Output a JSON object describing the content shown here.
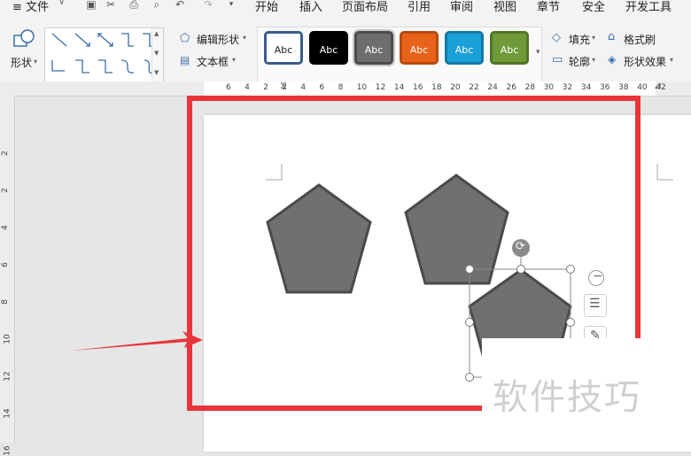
{
  "menu": {
    "file": "≡ 文件",
    "tabs": [
      "开始",
      "插入",
      "页面布局",
      "引用",
      "审阅",
      "视图",
      "章节",
      "安全",
      "开发工具"
    ]
  },
  "ribbon": {
    "shape_label": "形状",
    "edit_shape": "编辑形状",
    "text_box": "文本框",
    "style_text": "Abc",
    "styles": [
      {
        "bg": "#ffffff",
        "border": "#3b5c8e",
        "fg": "#222222"
      },
      {
        "bg": "#000000",
        "border": "#000000",
        "fg": "#ffffff"
      },
      {
        "bg": "#6e6e6e",
        "border": "#4c4c4c",
        "fg": "#ffffff"
      },
      {
        "bg": "#e8621a",
        "border": "#b94a10",
        "fg": "#ffffff"
      },
      {
        "bg": "#1aa0d8",
        "border": "#117aa7",
        "fg": "#ffffff"
      },
      {
        "bg": "#6e9a3a",
        "border": "#527428",
        "fg": "#ffffff"
      }
    ],
    "fill": "填充",
    "format_painter": "格式刷",
    "outline": "轮廓",
    "shape_effects": "形状效果"
  },
  "ruler": {
    "h_numbers": [
      "6",
      "4",
      "2",
      "2",
      "4",
      "6",
      "8",
      "10",
      "12",
      "14",
      "16",
      "18",
      "20",
      "22",
      "24",
      "26",
      "28",
      "30",
      "32",
      "34",
      "36",
      "38",
      "40",
      "42"
    ],
    "v_numbers": [
      "2",
      "2",
      "4",
      "6",
      "8",
      "10",
      "12",
      "14",
      "16"
    ]
  },
  "canvas": {
    "pentagon_fill": "#707070",
    "pentagon_stroke": "#4a4a4a"
  },
  "annotations": {
    "highlight_color": "#e8353a",
    "watermark": "软件技巧"
  }
}
